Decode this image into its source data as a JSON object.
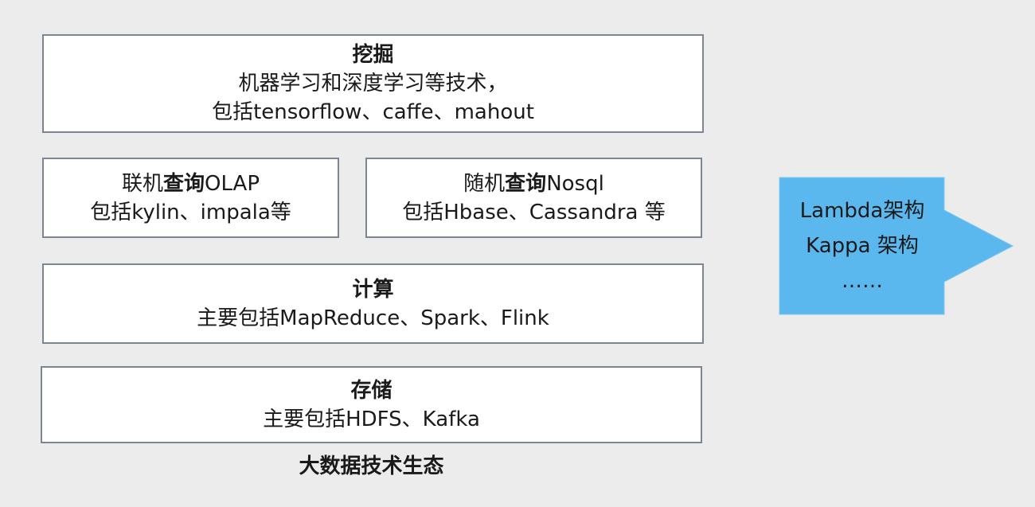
{
  "layers": {
    "mining": {
      "title": "挖掘",
      "line1": "机器学习和深度学习等技术，",
      "line2": "包括tensorflow、caffe、mahout"
    },
    "olap": {
      "prefix": "联机",
      "bold": "查询",
      "suffix": "OLAP",
      "line2": "包括kylin、impala等"
    },
    "nosql": {
      "prefix": "随机",
      "bold": "查询",
      "suffix": "Nosql",
      "line2": "包括Hbase、Cassandra 等"
    },
    "compute": {
      "title": "计算",
      "line2": "主要包括MapReduce、Spark、Flink"
    },
    "storage": {
      "title": "存储",
      "line2": "主要包括HDFS、Kafka"
    }
  },
  "caption": "大数据技术生态",
  "architectures": {
    "items": [
      "Lambda架构",
      "Kappa 架构",
      "……"
    ],
    "color": "#5bb8ee"
  }
}
